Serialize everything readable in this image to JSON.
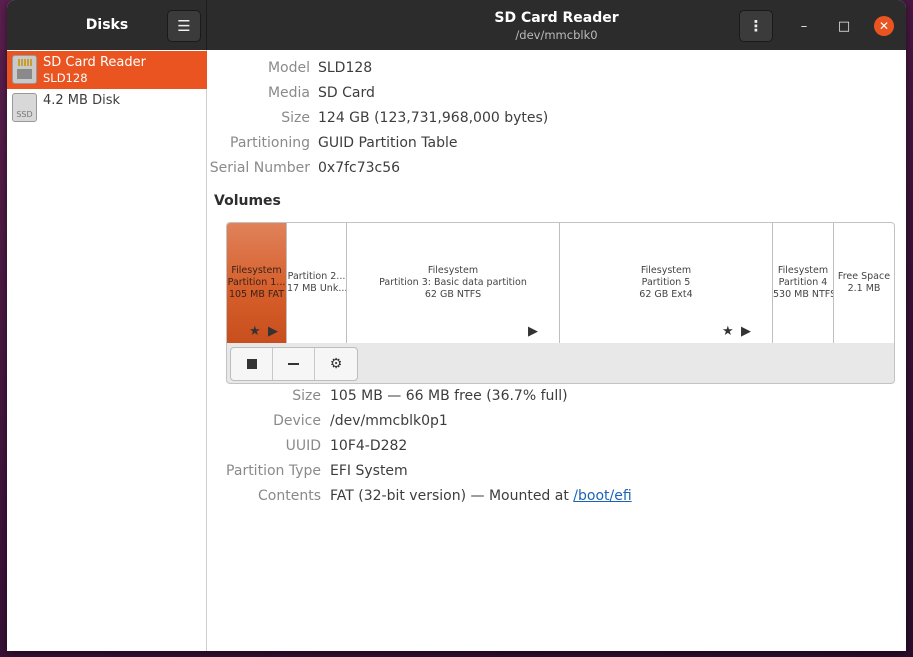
{
  "header": {
    "left_title": "Disks",
    "menu_icon": "hamburger-menu-icon",
    "title": "SD Card Reader",
    "subtitle": "/dev/mmcblk0",
    "more_icon": "vertical-dots-icon",
    "minimize": "–",
    "maximize": "□",
    "close": "✕"
  },
  "sidebar": {
    "items": [
      {
        "name": "SD Card Reader",
        "sub": "SLD128",
        "icon": "sd-card-icon",
        "selected": true
      },
      {
        "name": "4.2 MB Disk",
        "sub": "",
        "icon": "ssd-disk-icon",
        "icon_text": "SSD",
        "selected": false
      }
    ]
  },
  "drive": {
    "model_k": "Model",
    "model_v": "SLD128",
    "media_k": "Media",
    "media_v": "SD Card",
    "size_k": "Size",
    "size_v": "124 GB (123,731,968,000 bytes)",
    "part_k": "Partitioning",
    "part_v": "GUID Partition Table",
    "serial_k": "Serial Number",
    "serial_v": "0x7fc73c56"
  },
  "volumes_heading": "Volumes",
  "partitions": [
    {
      "l1": "Filesystem",
      "l2": "Partition 1...",
      "l3": "105 MB FAT",
      "selected": true
    },
    {
      "l1": "Partition 2...",
      "l2": "17 MB Unk...",
      "l3": ""
    },
    {
      "l1": "Filesystem",
      "l2": "Partition 3: Basic data partition",
      "l3": "62 GB NTFS"
    },
    {
      "l1": "Filesystem",
      "l2": "Partition 5",
      "l3": "62 GB Ext4"
    },
    {
      "l1": "Filesystem",
      "l2": "Partition 4",
      "l3": "530 MB NTFS"
    },
    {
      "l1": "Free Space",
      "l2": "2.1 MB",
      "l3": ""
    }
  ],
  "tools": {
    "stop": "stop-icon",
    "remove": "minus-icon",
    "settings": "gears-icon"
  },
  "volume": {
    "size_k": "Size",
    "size_v": "105 MB — 66 MB free (36.7% full)",
    "device_k": "Device",
    "device_v": "/dev/mmcblk0p1",
    "uuid_k": "UUID",
    "uuid_v": "10F4-D282",
    "ptype_k": "Partition Type",
    "ptype_v": "EFI System",
    "contents_k": "Contents",
    "contents_v": "FAT (32-bit version) — Mounted at ",
    "contents_link": "/boot/efi"
  },
  "colors": {
    "accent": "#e95420",
    "headerbar": "#2c2c2c",
    "link": "#1a64b8"
  }
}
